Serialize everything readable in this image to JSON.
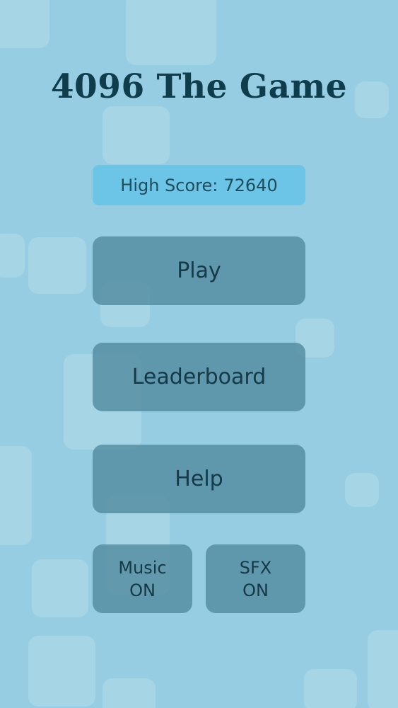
{
  "title": "4096 The Game",
  "high_score": {
    "label": "High Score:",
    "value": "72640"
  },
  "menu": {
    "play": "Play",
    "leaderboard": "Leaderboard",
    "help": "Help"
  },
  "toggles": {
    "music": {
      "label": "Music",
      "state": "ON"
    },
    "sfx": {
      "label": "SFX",
      "state": "ON"
    }
  },
  "colors": {
    "background": "#96cde2",
    "title": "#0f3d4c",
    "high_score_bg": "#6cc4e6",
    "button_bg": "#4d8497"
  }
}
